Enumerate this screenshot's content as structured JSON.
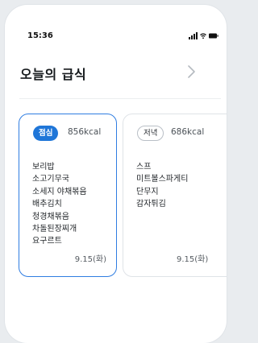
{
  "status_bar": {
    "time": "15:36",
    "icons": [
      "signal-icon",
      "wifi-icon",
      "battery-icon"
    ]
  },
  "header": {
    "title": "오늘의 급식",
    "chevron_icon": "chevron-right-icon"
  },
  "meals": [
    {
      "type_label": "점심",
      "kcal": "856kcal",
      "menu": [
        "보리밥",
        "소고기무국",
        "소세지 야채볶음",
        "배추김치",
        "청경채볶음",
        "차돌된장찌개",
        "요구르트"
      ],
      "date": "9.15(화)",
      "selected": true
    },
    {
      "type_label": "저녁",
      "kcal": "686kcal",
      "menu": [
        "스프",
        "미트볼스파게티",
        "단무지",
        "감자튀김"
      ],
      "date": "9.15(화)",
      "selected": false
    }
  ],
  "colors": {
    "accent": "#1f76d8",
    "card_selected_border": "#2f7de1",
    "card_border": "#dfe3e7"
  }
}
